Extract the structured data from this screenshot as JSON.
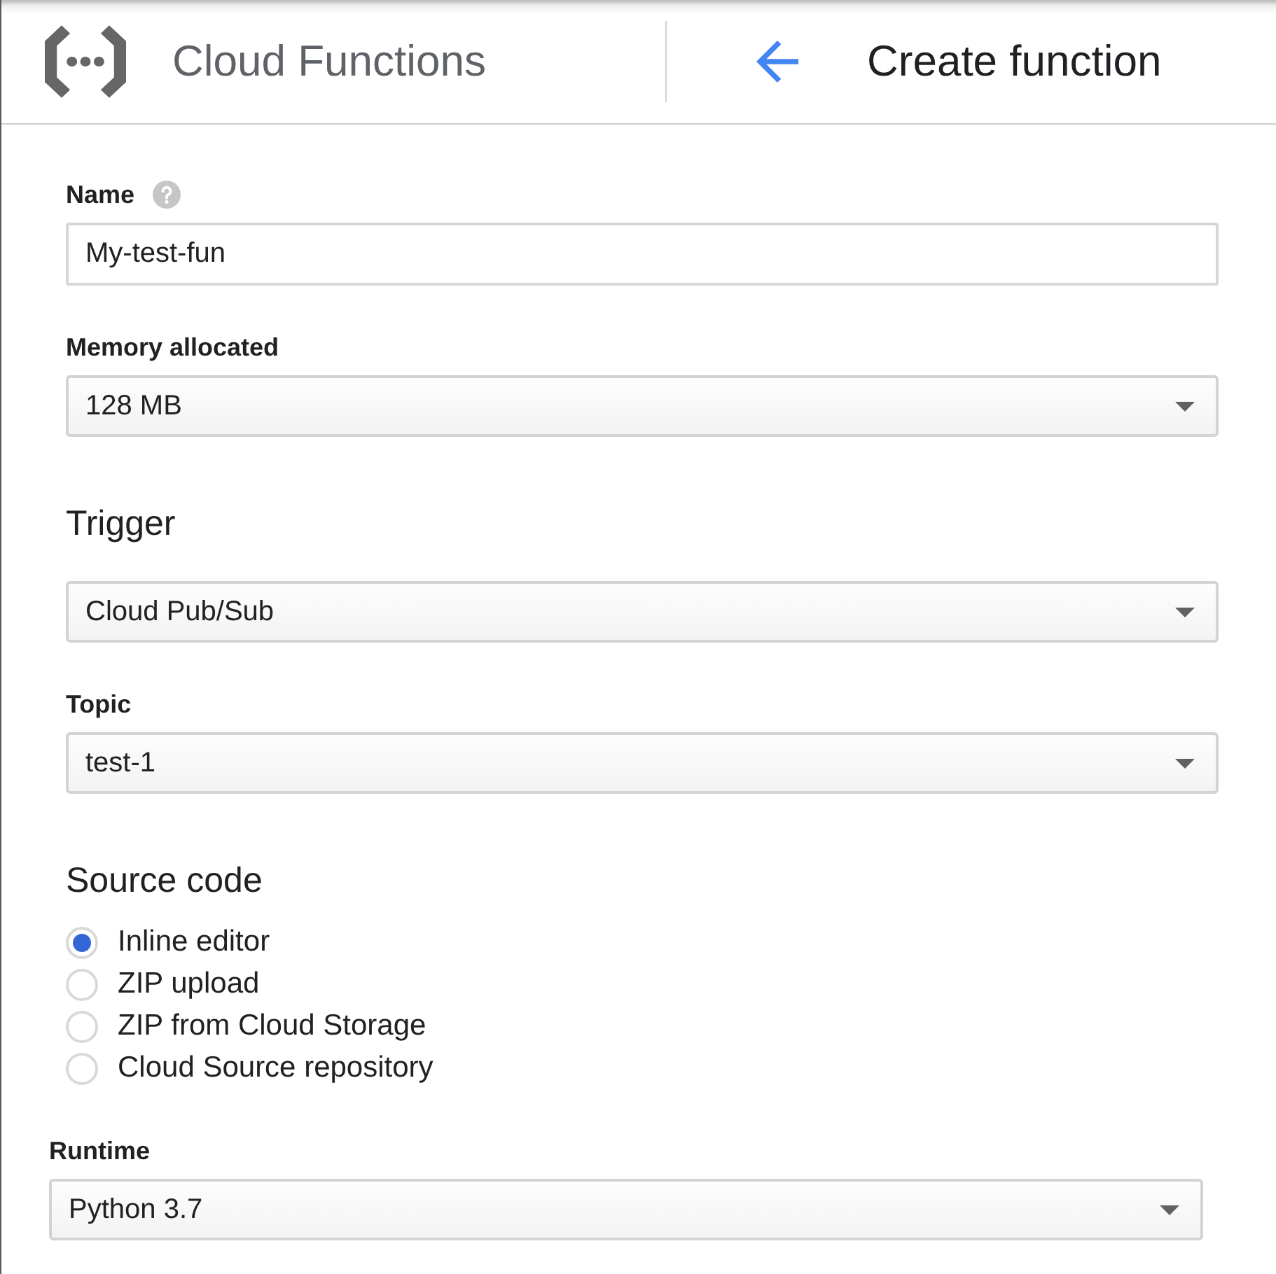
{
  "header": {
    "product_title": "Cloud Functions",
    "page_title": "Create function"
  },
  "form": [
    {
      "kind": "text",
      "label": "Name",
      "help_icon": true,
      "value": "My-test-fun"
    },
    {
      "kind": "select",
      "label": "Memory allocated",
      "value": "128 MB"
    },
    {
      "kind": "heading",
      "text": "Trigger"
    },
    {
      "kind": "select",
      "value": "Cloud Pub/Sub"
    },
    {
      "kind": "select",
      "label": "Topic",
      "value": "test-1"
    },
    {
      "kind": "heading",
      "text": "Source code"
    },
    {
      "kind": "radio_group",
      "options": [
        {
          "label": "Inline editor",
          "selected": true
        },
        {
          "label": "ZIP upload",
          "selected": false
        },
        {
          "label": "ZIP from Cloud Storage",
          "selected": false
        },
        {
          "label": "Cloud Source repository",
          "selected": false
        }
      ]
    }
  ],
  "runtime": {
    "kind": "select",
    "label": "Runtime",
    "value": "Python 3.7"
  }
}
